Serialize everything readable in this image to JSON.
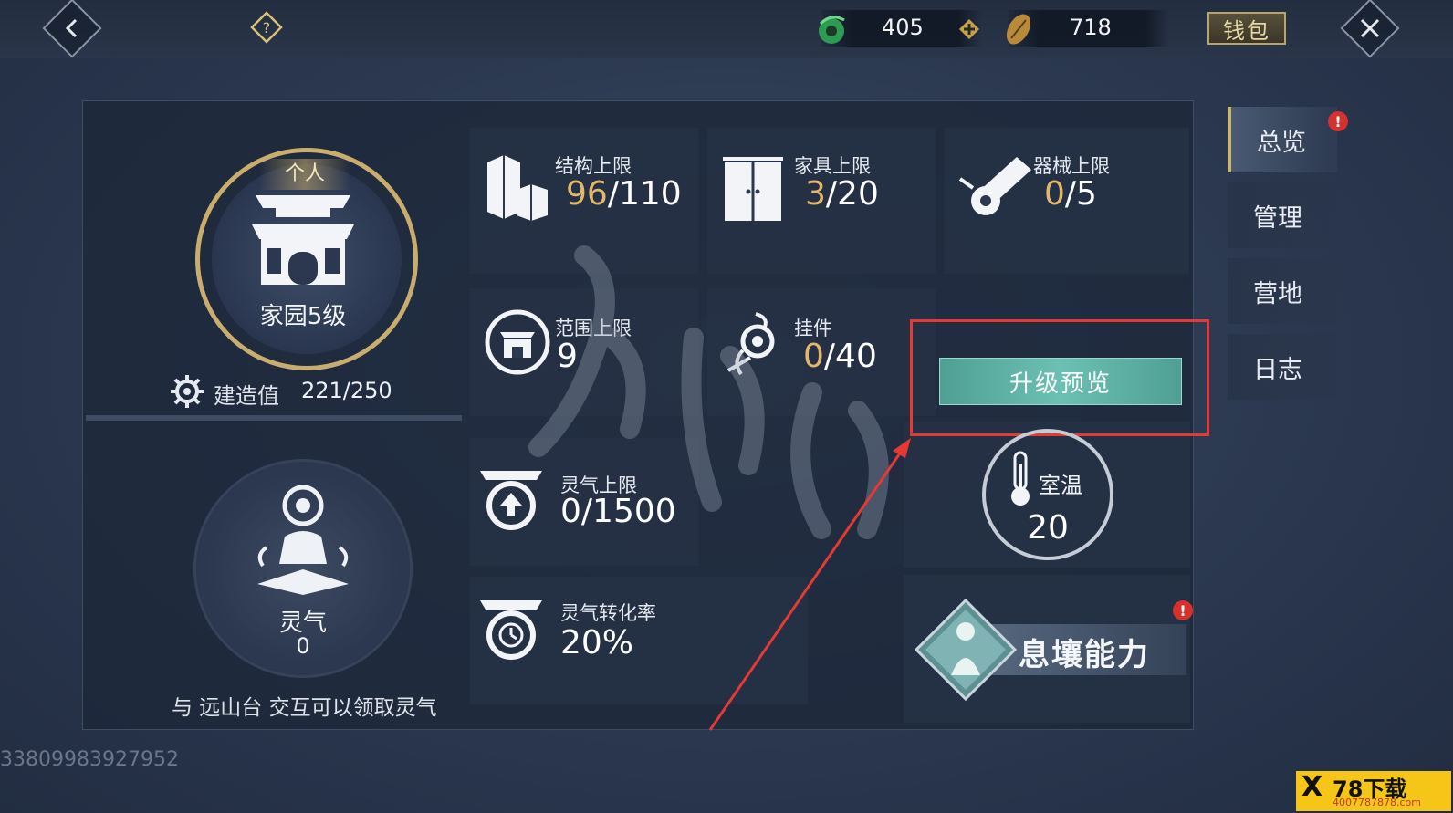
{
  "topbar": {
    "currency1_value": "405",
    "currency2_value": "718",
    "wallet_label": "钱包"
  },
  "home": {
    "tag": "个人",
    "level_label": "家园5级",
    "build_label": "建造值",
    "build_value": "221/250"
  },
  "stats": {
    "structure": {
      "label": "结构上限",
      "current": "96",
      "max": "/110"
    },
    "furniture": {
      "label": "家具上限",
      "current": "3",
      "max": "/20"
    },
    "machine": {
      "label": "器械上限",
      "current": "0",
      "max": "/5"
    },
    "range": {
      "label": "范围上限",
      "value": "9"
    },
    "pendant": {
      "label": "挂件",
      "current": "0",
      "max": "/40"
    },
    "aura_cap": {
      "label": "灵气上限",
      "value": "0/1500"
    },
    "aura_rate": {
      "label": "灵气转化率",
      "value": "20%"
    }
  },
  "upgrade_button": "升级预览",
  "temperature": {
    "label": "室温",
    "value": "20"
  },
  "ability": {
    "label": "息壤能力"
  },
  "aura": {
    "label": "灵气",
    "value": "0",
    "hint": "与 远山台 交互可以领取灵气"
  },
  "sidebar": {
    "items": [
      {
        "label": "总览"
      },
      {
        "label": "管理"
      },
      {
        "label": "营地"
      },
      {
        "label": "日志"
      }
    ]
  },
  "footer": {
    "player_id": "33809983927952",
    "watermark": "78下载",
    "watermark_url": "4007787878.com"
  },
  "colors": {
    "gold": "#e3b86a",
    "teal_button": "#5fb3a7",
    "highlight_red": "#e53935",
    "alert_red": "#d5322e"
  }
}
